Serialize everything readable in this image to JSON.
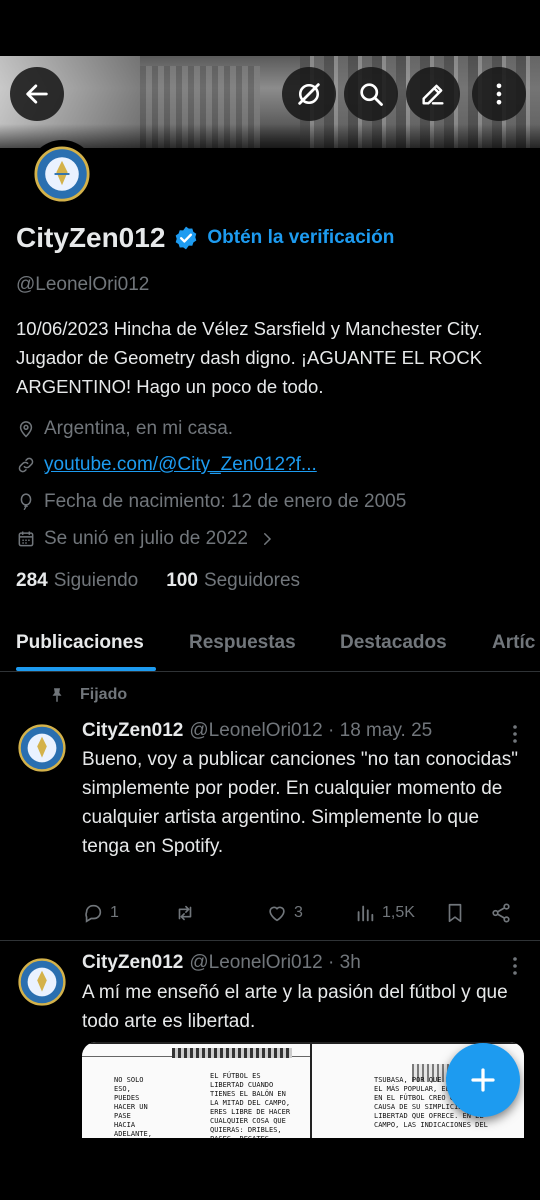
{
  "profile": {
    "name": "CityZen012",
    "get_verified": "Obtén la verificación",
    "handle": "@LeonelOri012",
    "bio": "10/06/2023 Hincha de Vélez Sarsfield y Manchester City.  Jugador de Geometry dash digno.  ¡AGUANTE EL ROCK ARGENTINO!  Hago un poco de todo.",
    "location": "Argentina, en mi casa.",
    "website": "youtube.com/@City_Zen012?f...",
    "birthday": "Fecha de nacimiento: 12 de enero de 2005",
    "joined": "Se unió en julio de 2022",
    "following_count": "284",
    "following_label": "Siguiendo",
    "followers_count": "100",
    "followers_label": "Seguidores"
  },
  "tabs": [
    "Publicaciones",
    "Respuestas",
    "Destacados",
    "Artíc"
  ],
  "pinned_label": "Fijado",
  "tweets": [
    {
      "name": "CityZen012",
      "meta": "@LeonelOri012 · 18 may. 25",
      "text": "Bueno, voy a publicar canciones \"no tan conocidas\" simplemente por poder. En cualquier momento de cualquier artista argentino. Simplemente lo que tenga en Spotify.",
      "replies": "1",
      "retweets": "",
      "likes": "3",
      "views": "1,5K"
    },
    {
      "name": "CityZen012",
      "meta": "@LeonelOri012 · 3h",
      "text": "A mí me enseñó el arte y la pasión del fútbol y que todo arte es libertad.",
      "media_text": [
        "NO SOLO ESO, PUEDES HACER UN PASE HACIA ADELANTE, A UN LADO, HACIA ATRÁS, EL ARBITRO TAMBIEN",
        "EL FÚTBOL ES LIBERTAD CUANDO TIENES EL BALÓN EN LA MITAD DEL CAMPO, ERES LIBRE DE HACER CUALQUIER COSA QUE QUIERAS: DRIBLES, PASES, REGATES, DISPAROS",
        "TSUBASA, POR QUE ES DIVERTIDO EL MÁS POPULAR, EL PRACTICADO EN EL FÚTBOL CREO QUE ES A CAUSA DE SU SIMPLICIDAD Y LA LIBERTAD QUE OFRECE. EN EL CAMPO, LAS INDICACIONES DEL"
      ]
    }
  ],
  "colors": {
    "accent": "#1d9bf0",
    "text": "#e7e9ea",
    "muted": "#71767b",
    "bg": "#000000"
  }
}
